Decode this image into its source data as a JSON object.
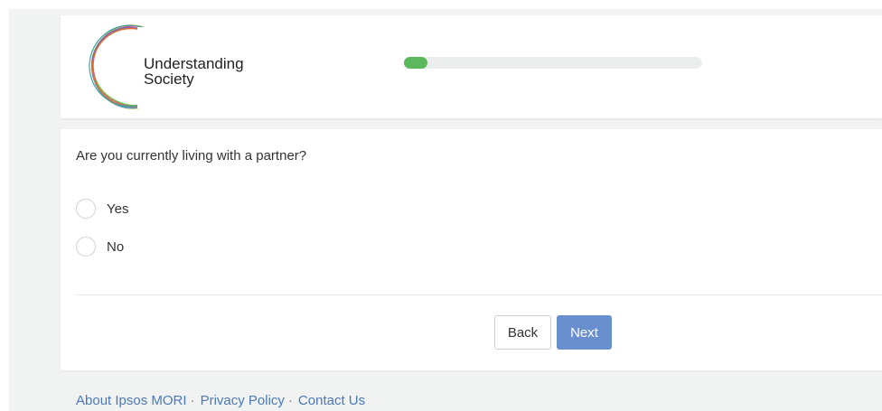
{
  "header": {
    "logo_line1": "Understanding",
    "logo_line2": "Society",
    "progress_fraction": 0.08,
    "progress_color": "#5cb85c"
  },
  "question": {
    "text": "Are you currently living with a partner?",
    "options": [
      {
        "label": "Yes",
        "selected": false
      },
      {
        "label": "No",
        "selected": false
      }
    ]
  },
  "buttons": {
    "back_label": "Back",
    "next_label": "Next",
    "next_color": "#6a8fcf"
  },
  "footer": {
    "links": [
      "About Ipsos MORI",
      "Privacy Policy",
      "Contact Us"
    ],
    "separator": "·",
    "link_color": "#4a78b8"
  },
  "icons": {
    "logo": "understanding-society-logo"
  }
}
